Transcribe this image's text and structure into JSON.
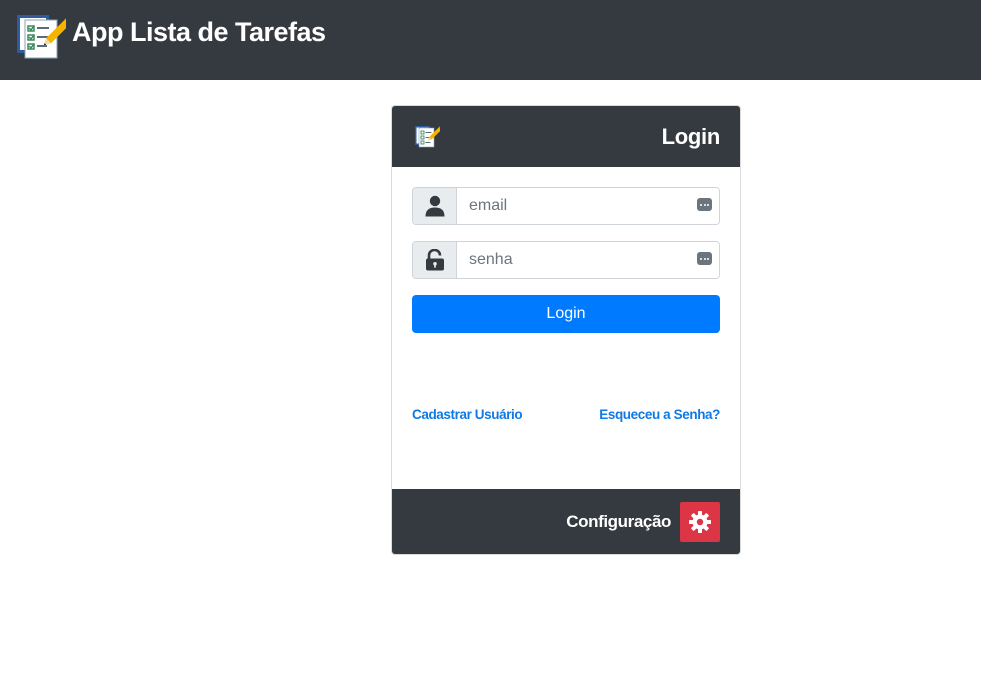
{
  "app": {
    "title": "App Lista de Tarefas",
    "logo_icon": "checklist-pencil-icon"
  },
  "login_card": {
    "header_icon": "checklist-pencil-icon",
    "title": "Login",
    "email": {
      "icon": "user-icon",
      "placeholder": "email",
      "value": "",
      "autofill_icon": "password-manager-icon"
    },
    "password": {
      "icon": "unlock-icon",
      "placeholder": "senha",
      "value": "",
      "autofill_icon": "password-manager-icon"
    },
    "submit_label": "Login",
    "register_link": "Cadastrar Usuário",
    "forgot_link": "Esqueceu a Senha?",
    "config_label": "Configuração",
    "config_icon": "gear-icon"
  },
  "colors": {
    "navbar_bg": "#343a40",
    "primary": "#007bff",
    "link": "#0f7ae5",
    "danger": "#dc3545",
    "input_addon_bg": "#e9ecef"
  }
}
